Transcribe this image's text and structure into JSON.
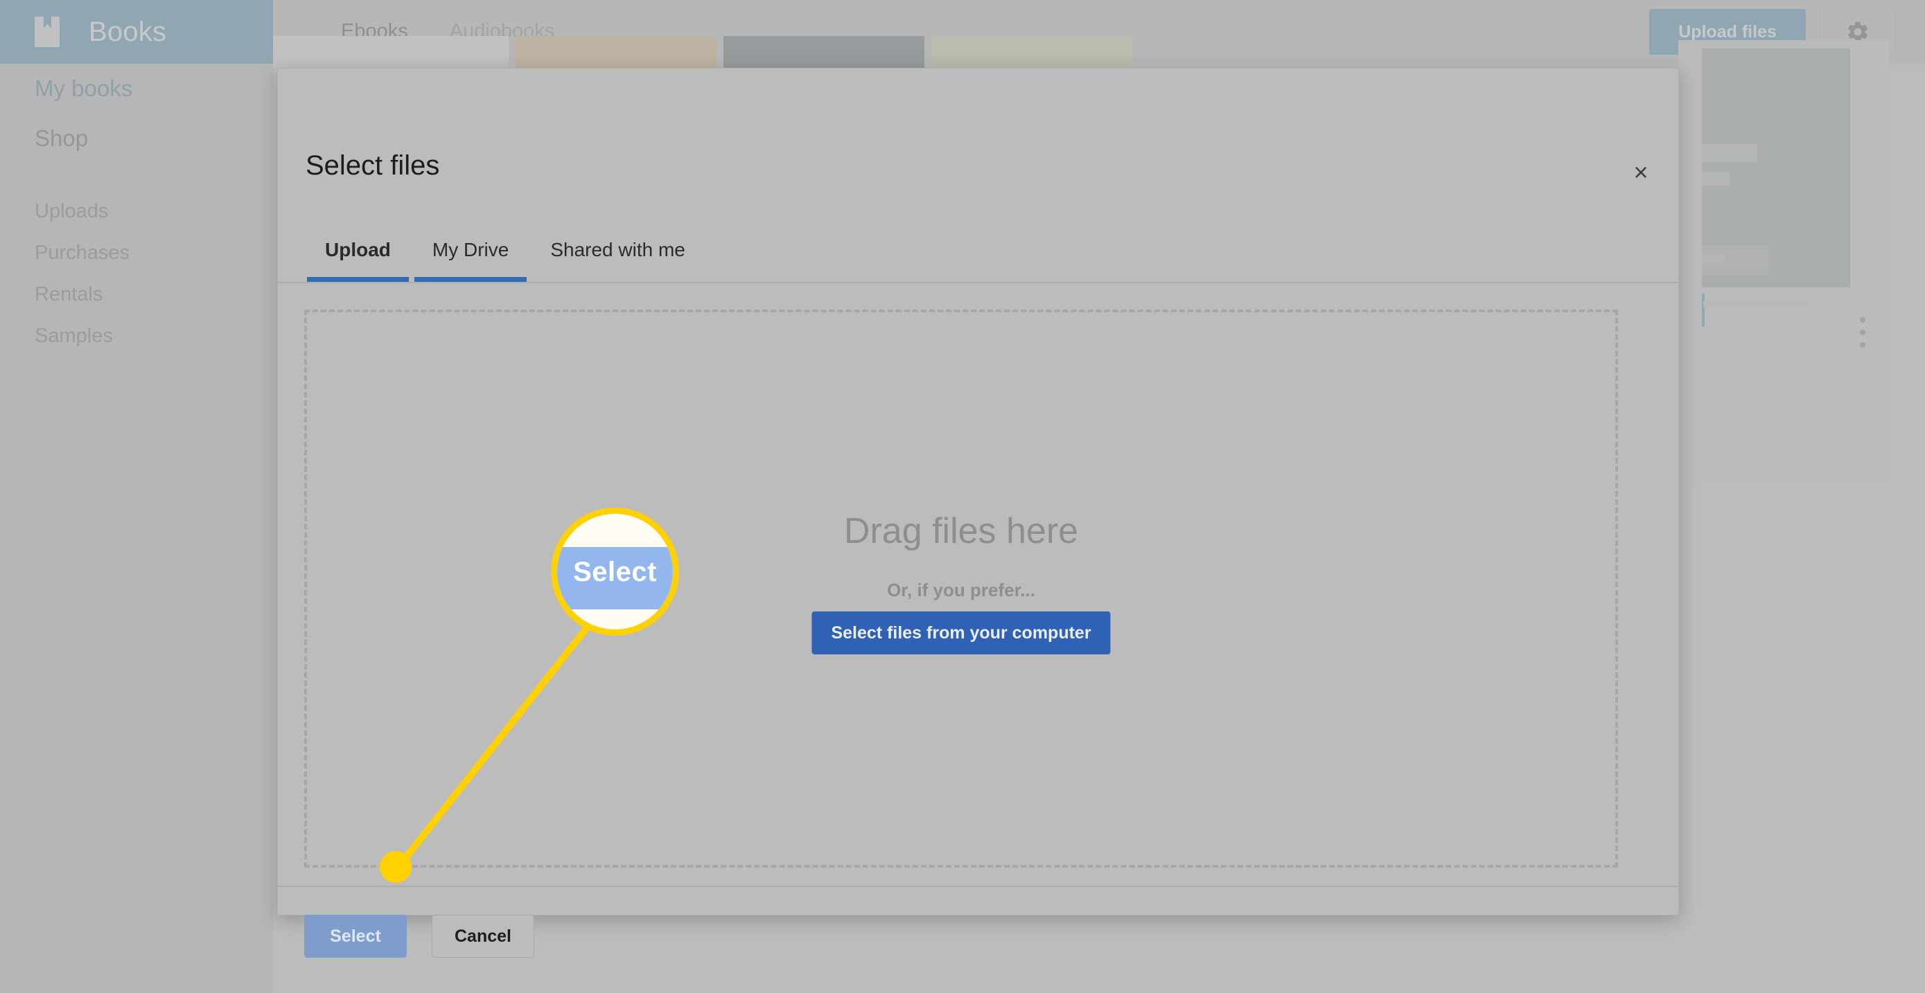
{
  "app": {
    "brand_title": "Books",
    "brand_icon": "bookmark-icon",
    "sidebar": {
      "items": [
        {
          "label": "My books",
          "active": true
        },
        {
          "label": "Shop",
          "active": false
        },
        {
          "label": "Uploads",
          "active": false
        },
        {
          "label": "Purchases",
          "active": false
        },
        {
          "label": "Rentals",
          "active": false
        },
        {
          "label": "Samples",
          "active": false
        }
      ]
    },
    "topbar": {
      "tabs": [
        {
          "label": "Ebooks",
          "active": true
        },
        {
          "label": "Audiobooks",
          "active": false
        }
      ],
      "upload_files_label": "Upload files",
      "settings_icon": "gear-icon"
    }
  },
  "dialog": {
    "title": "Select files",
    "close_icon": "close-icon",
    "tabs": [
      {
        "label": "Upload",
        "active": true,
        "underline": true
      },
      {
        "label": "My Drive",
        "active": false,
        "underline": true
      },
      {
        "label": "Shared with me",
        "active": false,
        "underline": false
      }
    ],
    "dropzone": {
      "headline": "Drag files here",
      "subtext": "Or, if you prefer...",
      "button_label": "Select files from your computer"
    },
    "footer": {
      "select_label": "Select",
      "cancel_label": "Cancel"
    }
  },
  "callout": {
    "magnifier_label": "Select",
    "accent_color": "#FFD100"
  },
  "colors": {
    "brand_blue": "#5f94b0",
    "dialog_accent": "#2f6ab5",
    "primary_button": "#2f62b4",
    "page_background": "#b9b9b9"
  }
}
